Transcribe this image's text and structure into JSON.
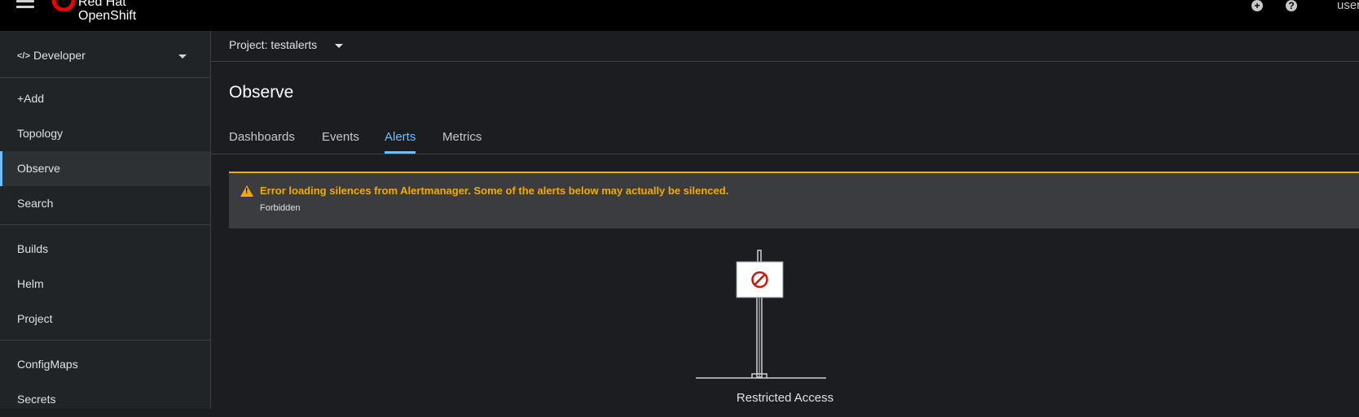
{
  "masthead": {
    "brand_line1": "Red Hat",
    "brand_line2": "OpenShift",
    "user": "user"
  },
  "sidebar": {
    "perspective": "Developer",
    "groups": [
      [
        "+Add",
        "Topology",
        "Observe",
        "Search"
      ],
      [
        "Builds",
        "Helm",
        "Project"
      ],
      [
        "ConfigMaps",
        "Secrets"
      ]
    ]
  },
  "project_bar": {
    "label": "Project: testalerts"
  },
  "page": {
    "title": "Observe",
    "tabs": [
      "Dashboards",
      "Events",
      "Alerts",
      "Metrics"
    ],
    "active_tab": "Alerts"
  },
  "alert": {
    "title": "Error loading silences from Alertmanager. Some of the alerts below may actually be silenced.",
    "body": "Forbidden"
  },
  "empty_state": {
    "title": "Restricted Access"
  },
  "colors": {
    "accent": "#73bcf7",
    "warning": "#f0ab00",
    "danger": "#c9190b"
  }
}
